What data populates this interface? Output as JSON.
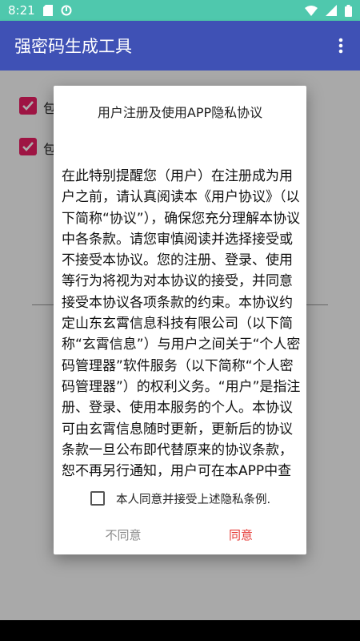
{
  "status_bar": {
    "time": "8:21",
    "icons": [
      "sd-card-icon",
      "sync-icon",
      "wifi-icon",
      "signal-icon",
      "battery-icon"
    ],
    "color": "#4fc8ad"
  },
  "app_bar": {
    "title": "强密码生成工具",
    "color": "#3f51b5",
    "menu_icon": "more-vert-icon"
  },
  "background": {
    "checkbox_color": "#e91e63",
    "options": [
      {
        "label": "包",
        "checked": true
      },
      {
        "label": "包",
        "checked": true
      }
    ]
  },
  "dialog": {
    "title": "用户注册及使用APP隐私协议",
    "body": "在此特别提醒您（用户）在注册成为用户之前，请认真阅读本《用户协议》（以下简称“协议”），确保您充分理解本协议中各条款。请您审慎阅读并选择接受或不接受本协议。您的注册、登录、使用等行为将视为对本协议的接受，并同意接受本协议各项条款的约束。本协议约定山东玄霄信息科技有限公司（以下简称“玄霄信息”）与用户之间关于“个人密码管理器”软件服务（以下简称“个人密码管理器”）的权利义务。“用户”是指注册、登录、使用本服务的个人。本协议可由玄霄信息随时更新，更新后的协议条款一旦公布即代替原来的协议条款，恕不再另行通知，用户可在本APP中查阅最新版协议条",
    "agree_checkbox_label": "本人同意并接受上述隐私条例.",
    "agree_checked": false,
    "disagree_label": "不同意",
    "agree_label": "同意",
    "agree_color": "#e53935",
    "disagree_color": "#8a8a8a"
  }
}
